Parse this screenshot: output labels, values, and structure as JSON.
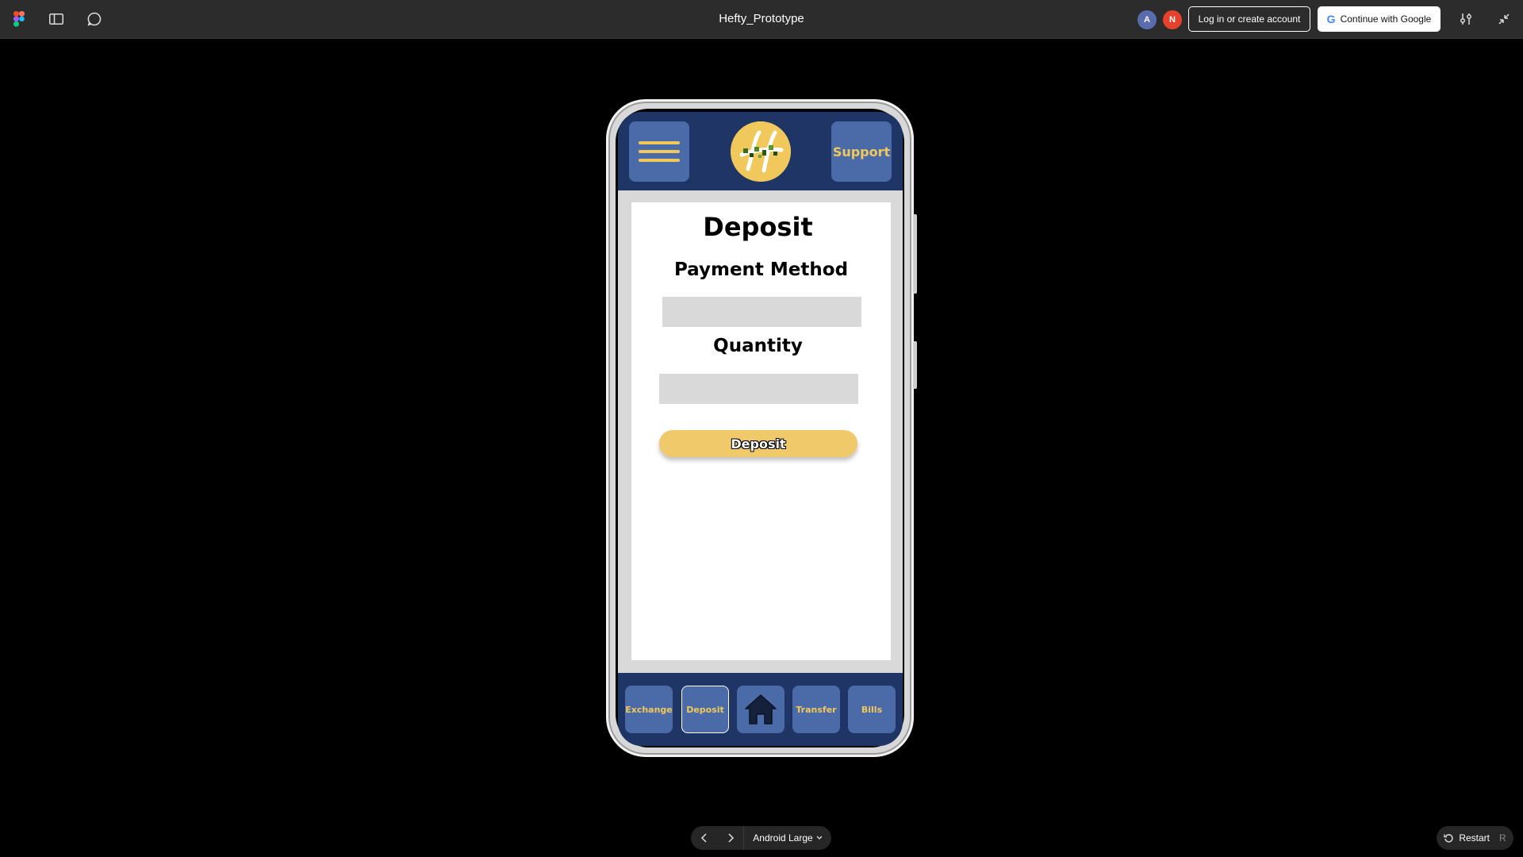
{
  "toolbar": {
    "title": "Hefty_Prototype",
    "avatars": [
      "A",
      "N"
    ],
    "login_label": "Log in or create account",
    "google_label": "Continue with Google",
    "google_glyph": "G",
    "icons": [
      "figma-logo-icon",
      "sidebar-toggle-icon",
      "comment-icon",
      "settings-sliders-icon",
      "collapse-icon"
    ]
  },
  "app": {
    "support_label": "Support",
    "page_title": "Deposit",
    "payment_method_label": "Payment Method",
    "payment_method_value": "",
    "quantity_label": "Quantity",
    "quantity_value": "",
    "deposit_button_label": "Deposit",
    "nav": {
      "exchange": "Exchange",
      "deposit": "Deposit",
      "transfer": "Transfer",
      "bills": "Bills"
    },
    "active_nav": "deposit"
  },
  "footer": {
    "device_label": "Android Large",
    "restart_label": "Restart",
    "restart_shortcut": "R"
  },
  "colors": {
    "toolbar_bg": "#2c2c2c",
    "app_navy": "#1f3566",
    "button_blue": "#4a6ba8",
    "accent_gold": "#f0c85c",
    "field_gray": "#d9d9d9"
  }
}
